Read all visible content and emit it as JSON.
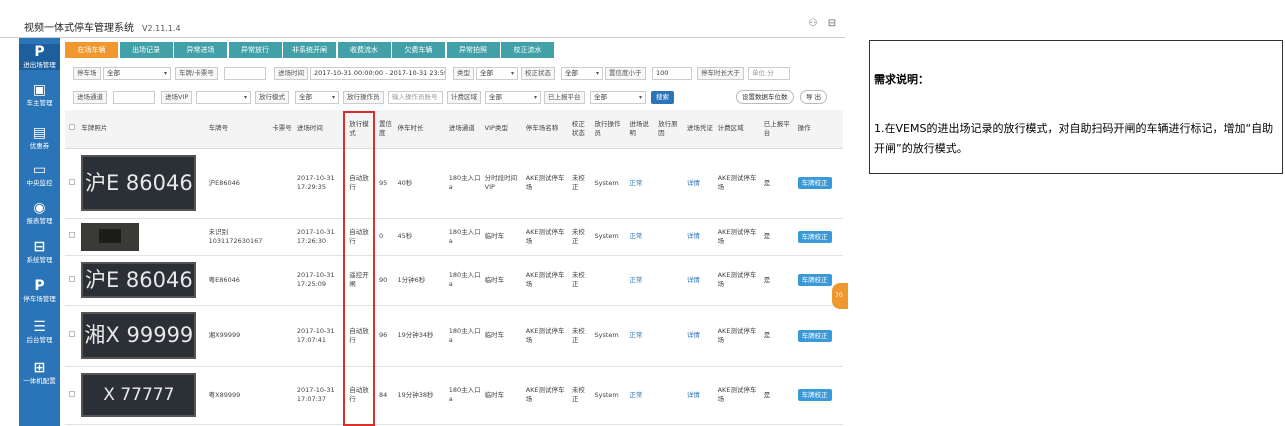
{
  "app": {
    "title": "视频一体式停车管理系统",
    "version": "V2.11.1.4"
  },
  "topbar": {
    "user_icon": "user-icon",
    "logout_icon": "logout-icon"
  },
  "sidebar": {
    "items": [
      {
        "icon": "P",
        "label": "进出场管理",
        "name": "parking-icon"
      },
      {
        "icon": "▣",
        "label": "车主管理",
        "name": "owner-card-icon"
      },
      {
        "icon": "▤",
        "label": "优惠券",
        "name": "coupon-icon"
      },
      {
        "icon": "▭",
        "label": "中央监控",
        "name": "monitor-icon"
      },
      {
        "icon": "◉",
        "label": "报表管理",
        "name": "report-icon"
      },
      {
        "icon": "⊟",
        "label": "系统管理",
        "name": "system-icon"
      },
      {
        "icon": "P",
        "label": "停车场管理",
        "name": "parking-lot-icon"
      },
      {
        "icon": "☰",
        "label": "后台管理",
        "name": "backend-icon"
      },
      {
        "icon": "⊞",
        "label": "一体机配置",
        "name": "device-config-icon"
      }
    ]
  },
  "tabs": [
    {
      "label": "在场车辆",
      "active": true
    },
    {
      "label": "出场记录"
    },
    {
      "label": "异常进场"
    },
    {
      "label": "异常放行"
    },
    {
      "label": "非系统开闸"
    },
    {
      "label": "收费流水"
    },
    {
      "label": "欠费车辆"
    },
    {
      "label": "异常拍照"
    },
    {
      "label": "校正流水"
    }
  ],
  "filters": {
    "row1": {
      "lot_label": "停车场",
      "lot_value": "全部",
      "plate_label": "车牌/卡票号",
      "plate_value": "",
      "time_label": "进场时间",
      "time_value": "2017-10-31 00:00:00 - 2017-10-31 23:59:59",
      "type_label": "类型",
      "type_value": "全部",
      "correct_label": "校正状态",
      "correct_value": "全部",
      "conf_label": "置信度小于",
      "conf_value": "100",
      "duration_label": "停车时长大于",
      "duration_placeholder": "单位:分"
    },
    "row2": {
      "channel_label": "进场通道",
      "channel_value": "",
      "vip_label": "进场VIP",
      "vip_value": "",
      "mode_label": "放行模式",
      "mode_value": "全部",
      "operator_label": "放行操作员",
      "operator_placeholder": "输入操作员账号",
      "area_label": "计费区域",
      "area_value": "全部",
      "reported_label": "已上报平台",
      "reported_value": "全部",
      "search_button": "搜索",
      "set_count_button": "设置数据车位数",
      "export_button": "导 出"
    }
  },
  "table": {
    "headers": [
      "",
      "车牌照片",
      "车牌号",
      "卡票号",
      "进场时间",
      "放行模式",
      "置信度",
      "停车时长",
      "进场通道",
      "VIP类型",
      "停车场名称",
      "校正状态",
      "放行操作员",
      "进场说明",
      "放行原因",
      "进场凭证",
      "计费区域",
      "已上报平台",
      "操作"
    ],
    "rows": [
      {
        "photo_plate": "沪E 86046",
        "plate": "沪E86046",
        "card": "",
        "time": "2017-10-31 17:29:35",
        "mode": "自动放行",
        "conf": "95",
        "duration": "40秒",
        "channel": "180主入口a",
        "vip": "分时段时间VIP",
        "lot": "AKE测试停车场",
        "correct": "未校正",
        "operator": "System",
        "note": "正常",
        "reason": "",
        "proof": "详情",
        "area": "AKE测试停车场",
        "reported": "是",
        "action": "车牌校正"
      },
      {
        "photo_plate": "",
        "plate": "未识别1031172630167",
        "card": "",
        "time": "2017-10-31 17:26:30",
        "mode": "自动放行",
        "conf": "0",
        "duration": "45秒",
        "channel": "180主入口a",
        "vip": "临时车",
        "lot": "AKE测试停车场",
        "correct": "未校正",
        "operator": "System",
        "note": "正常",
        "reason": "",
        "proof": "详情",
        "area": "AKE测试停车场",
        "reported": "是",
        "action": "车牌校正"
      },
      {
        "photo_plate": "沪E 86046",
        "plate": "粤E86046",
        "card": "",
        "time": "2017-10-31 17:25:09",
        "mode": "遥控开闸",
        "conf": "90",
        "duration": "1分钟6秒",
        "channel": "180主入口a",
        "vip": "临时车",
        "lot": "AKE测试停车场",
        "correct": "未校正",
        "operator": "",
        "note": "正常",
        "reason": "",
        "proof": "详情",
        "area": "AKE测试停车场",
        "reported": "是",
        "action": "车牌校正"
      },
      {
        "photo_plate": "湘X 99999",
        "plate": "湘X99999",
        "card": "",
        "time": "2017-10-31 17:07:41",
        "mode": "自动放行",
        "conf": "96",
        "duration": "19分钟34秒",
        "channel": "180主入口a",
        "vip": "临时车",
        "lot": "AKE测试停车场",
        "correct": "未校正",
        "operator": "System",
        "note": "正常",
        "reason": "",
        "proof": "详情",
        "area": "AKE测试停车场",
        "reported": "是",
        "action": "车牌校正"
      },
      {
        "photo_plate": "X 77777",
        "plate": "粤X89999",
        "card": "",
        "time": "2017-10-31 17:07:37",
        "mode": "自动放行",
        "conf": "84",
        "duration": "19分钟38秒",
        "channel": "180主入口a",
        "vip": "临时车",
        "lot": "AKE测试停车场",
        "correct": "未校正",
        "operator": "System",
        "note": "正常",
        "reason": "",
        "proof": "详情",
        "area": "AKE测试停车场",
        "reported": "是",
        "action": "车牌校正"
      }
    ]
  },
  "side_badge": "70",
  "requirement": {
    "heading": "需求说明：",
    "body": "1.在VEMS的进出场记录的放行模式，对自助扫码开闸的车辆进行标记，增加“自助开闸”的放行模式。"
  },
  "colors": {
    "sidebar": "#2a74b8",
    "tab": "#42a0a8",
    "tab_active": "#f0982d",
    "highlight_box": "#d9302a",
    "action_button": "#3a9ad9"
  }
}
